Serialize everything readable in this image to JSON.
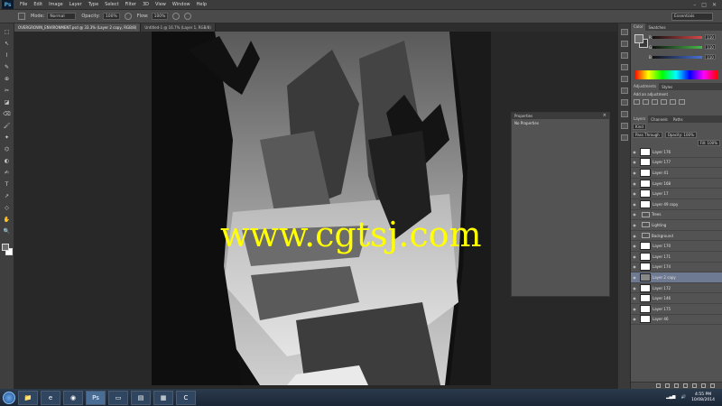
{
  "app": {
    "logo": "Ps"
  },
  "menu": [
    "File",
    "Edit",
    "Image",
    "Layer",
    "Type",
    "Select",
    "Filter",
    "3D",
    "View",
    "Window",
    "Help"
  ],
  "window_controls": [
    "–",
    "□",
    "✕"
  ],
  "options": {
    "mode_label": "Mode:",
    "mode_value": "Normal",
    "opacity_label": "Opacity:",
    "opacity_value": "100%",
    "flow_label": "Flow:",
    "flow_value": "100%",
    "workspace": "Essentials"
  },
  "tools": [
    "⬚",
    "↖",
    "⌇",
    "✎",
    "⊕",
    "✂",
    "◪",
    "⌫",
    "🖌",
    "✦",
    "⌬",
    "◐",
    "✍",
    "T",
    "↗",
    "◇",
    "✋",
    "🔍"
  ],
  "document_tabs": [
    {
      "label": "OVERGROWN_ENVIRONMENT.psd @ 33.3% (Layer 2 copy, RGB/8)",
      "active": true
    },
    {
      "label": "Untitled-1 @ 16.7% (Layer 1, RGB/8)",
      "active": false
    }
  ],
  "watermark": "www.cgtsj.com",
  "properties": {
    "title": "Properties",
    "subtitle": "No Properties",
    "close": "×"
  },
  "color_panel": {
    "tabs": [
      "Color",
      "Swatches"
    ],
    "sliders": [
      {
        "label": "R",
        "value": "110",
        "color": "#d94848"
      },
      {
        "label": "G",
        "value": "110",
        "color": "#48b848"
      },
      {
        "label": "B",
        "value": "110",
        "color": "#4870d9"
      }
    ]
  },
  "adjustments_panel": {
    "tabs": [
      "Adjustments",
      "Styles"
    ],
    "subtitle": "Add an adjustment"
  },
  "layers_panel": {
    "tabs": [
      "Layers",
      "Channels",
      "Paths"
    ],
    "kind": "Kind",
    "blend": "Pass Through",
    "opacity": "Opacity: 100%",
    "fill": "Fill: 100%",
    "layers": [
      {
        "name": "Layer 176",
        "type": "layer",
        "thumb": "white",
        "selected": false
      },
      {
        "name": "Layer 177",
        "type": "layer",
        "thumb": "white",
        "selected": false
      },
      {
        "name": "Layer 41",
        "type": "layer",
        "thumb": "white",
        "selected": false
      },
      {
        "name": "Layer 168",
        "type": "layer",
        "thumb": "white",
        "selected": false
      },
      {
        "name": "Layer 17",
        "type": "layer",
        "thumb": "white",
        "selected": false
      },
      {
        "name": "Layer 49 copy",
        "type": "layer",
        "thumb": "white",
        "selected": false
      },
      {
        "name": "Trees",
        "type": "folder",
        "selected": false
      },
      {
        "name": "Lighting",
        "type": "folder",
        "selected": false
      },
      {
        "name": "Background",
        "type": "folder",
        "selected": false
      },
      {
        "name": "Layer 170",
        "type": "layer",
        "thumb": "white",
        "selected": false
      },
      {
        "name": "Layer 171",
        "type": "layer",
        "thumb": "white",
        "selected": false
      },
      {
        "name": "Layer 174",
        "type": "layer",
        "thumb": "white",
        "selected": false
      },
      {
        "name": "Layer 2 copy",
        "type": "layer",
        "thumb": "dark",
        "selected": true
      },
      {
        "name": "Layer 172",
        "type": "layer",
        "thumb": "white",
        "selected": false
      },
      {
        "name": "Layer 146",
        "type": "layer",
        "thumb": "white",
        "selected": false
      },
      {
        "name": "Layer 175",
        "type": "layer",
        "thumb": "white",
        "selected": false
      },
      {
        "name": "Layer 46",
        "type": "layer",
        "thumb": "white",
        "selected": false
      }
    ]
  },
  "taskbar": {
    "apps": [
      "📁",
      "e",
      "◉",
      "Ps",
      "▭",
      "▤",
      "▦",
      "C"
    ],
    "time": "4:55 PM",
    "date": "10/08/2014"
  }
}
